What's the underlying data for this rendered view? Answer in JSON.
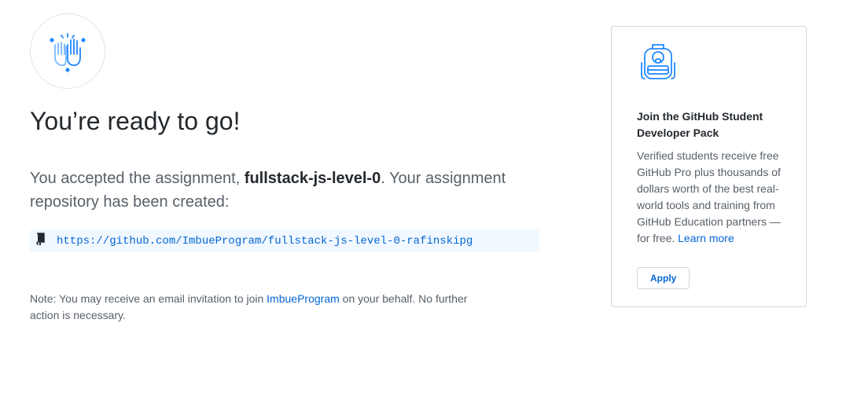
{
  "hero": {
    "icon": "high-five-icon"
  },
  "title": "You’re ready to go!",
  "lead": {
    "prefix": "You accepted the assignment, ",
    "assignment": "fullstack-js-level-0",
    "suffix": ". Your assignment repository has been created:"
  },
  "repo": {
    "icon": "repo-icon",
    "url": "https://github.com/ImbueProgram/fullstack-js-level-0-rafinskipg"
  },
  "note": {
    "prefix": "Note: You may receive an email invitation to join ",
    "org": "ImbueProgram",
    "suffix": " on your behalf. No further action is necessary."
  },
  "sidebar": {
    "icon": "backpack-icon",
    "heading": "Join the GitHub Student Developer Pack",
    "body": "Verified students receive free GitHub Pro plus thousands of dollars worth of the best real-world tools and training from GitHub Education partners — for free. ",
    "learn_more": "Learn more",
    "apply_label": "Apply"
  },
  "colors": {
    "accent": "#0366d6",
    "icon_blue": "#2188ff",
    "repo_bg": "#f1f8ff"
  }
}
